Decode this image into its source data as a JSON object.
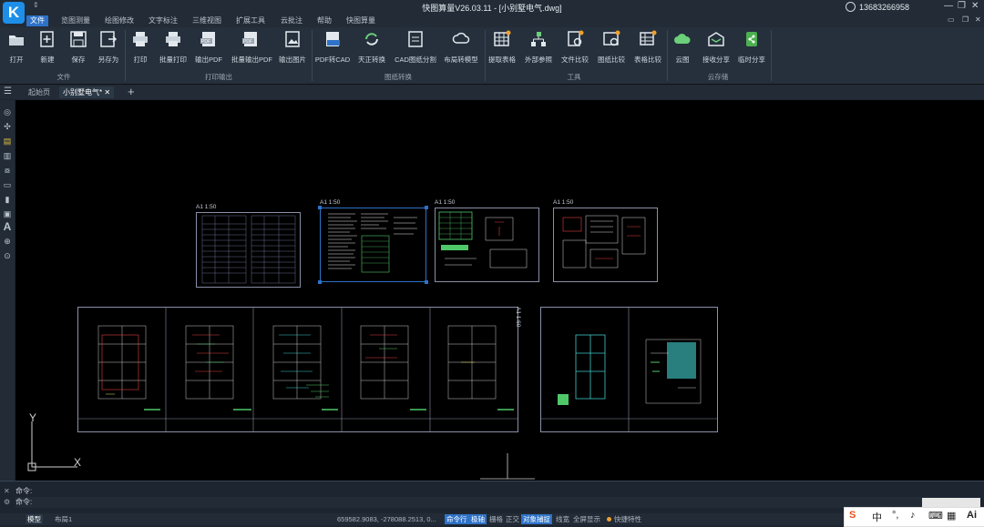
{
  "app": {
    "title": "快图算量V26.03.11 - [小别墅电气.dwg]",
    "logo": "K",
    "user": "13683266958"
  },
  "menu": [
    "文件",
    "览图测量",
    "绘图修改",
    "文字标注",
    "三维视图",
    "扩展工具",
    "云批注",
    "帮助",
    "快图算量"
  ],
  "ribbon": {
    "tools": [
      "打开",
      "新建",
      "保存",
      "另存为",
      "打印",
      "批量打印",
      "输出PDF",
      "批量输出PDF",
      "输出图片",
      "PDF转CAD",
      "天正转换",
      "CAD图纸分割",
      "布局转模型",
      "提取表格",
      "外部参照",
      "文件比较",
      "图纸比较",
      "表格比较",
      "云图",
      "接收分享",
      "临时分享"
    ],
    "groups": [
      "文件",
      "打印输出",
      "图纸转换",
      "工具",
      "云存储"
    ]
  },
  "tabs": [
    "起始页",
    "小别墅电气*"
  ],
  "canvas": {
    "axis_y": "Y",
    "axis_x": "X",
    "scale_labels": [
      "A1 1:50",
      "A1 1:50",
      "A1 1:50",
      "A1 1:50"
    ],
    "vertical_label": "A1 1:60"
  },
  "command": {
    "line1": "命令:",
    "line2": "命令:"
  },
  "status": {
    "model_tab": "模型",
    "layout_tab": "布局1",
    "coords": "659582.9083, -278088.2513, 0...",
    "toggles": [
      "命令行",
      "极轴",
      "栅格",
      "正交",
      "对象捕捉",
      "线宽",
      "全屏显示",
      "快捷特性"
    ]
  },
  "ime": {
    "mode": "中"
  },
  "colors": {
    "accent": "#2e72c8",
    "canvas_bg": "#000000",
    "chrome": "#222b36"
  }
}
